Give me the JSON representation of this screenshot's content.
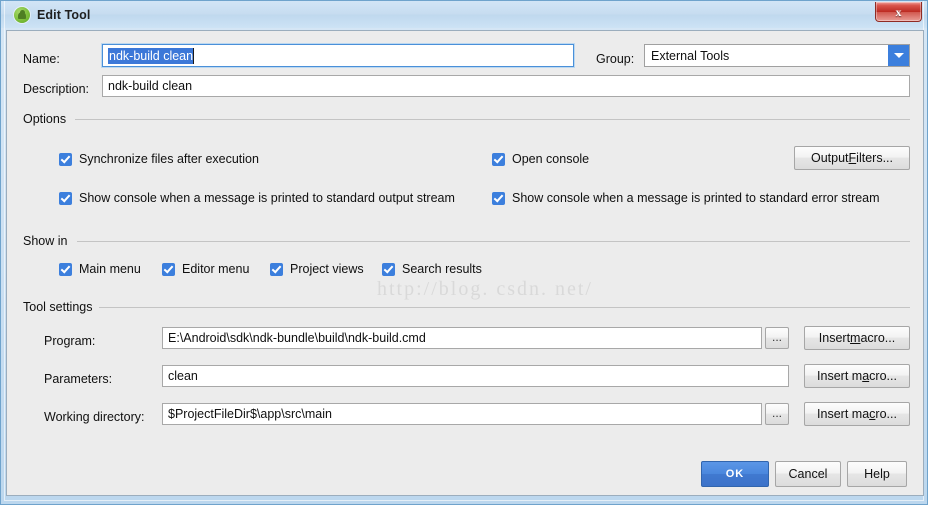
{
  "window": {
    "title": "Edit Tool",
    "app_icon": "android-robot-icon",
    "close_label": "x",
    "accent_color": "#3c7fdd",
    "dialog_bg": "#ececec"
  },
  "watermark": "http://blog. csdn. net/",
  "fields": {
    "name_label": "Name:",
    "name_value": "ndk-build clean",
    "name_selected": true,
    "description_label": "Description:",
    "description_value": "ndk-build clean",
    "group_label": "Group:",
    "group_value": "External Tools"
  },
  "options": {
    "title": "Options",
    "checkboxes": [
      {
        "label": "Synchronize files after execution",
        "checked": true
      },
      {
        "label": "Open console",
        "checked": true
      },
      {
        "label": "Show console when a message is printed to standard output stream",
        "checked": true
      },
      {
        "label": "Show console when a message is printed to standard error stream",
        "checked": true
      }
    ],
    "output_filters_pre": "Output ",
    "output_filters_accel": "F",
    "output_filters_post": "ilters..."
  },
  "show_in": {
    "title": "Show in",
    "checkboxes": [
      {
        "label": "Main menu",
        "checked": true
      },
      {
        "label": "Editor menu",
        "checked": true
      },
      {
        "label": "Project views",
        "checked": true
      },
      {
        "label": "Search results",
        "checked": true
      }
    ]
  },
  "tool_settings": {
    "title": "Tool settings",
    "program_label": "Program:",
    "program_value": "E:\\Android\\sdk\\ndk-bundle\\build\\ndk-build.cmd",
    "parameters_label": "Parameters:",
    "parameters_value": "clean",
    "working_directory_label": "Working directory:",
    "working_directory_value": "$ProjectFileDir$\\app\\src\\main",
    "browse_label": "...",
    "macro_buttons": [
      {
        "pre": "Insert ",
        "accel": "m",
        "post": "acro..."
      },
      {
        "pre": "Insert m",
        "accel": "a",
        "post": "cro..."
      },
      {
        "pre": "Insert ma",
        "accel": "c",
        "post": "ro..."
      }
    ]
  },
  "footer": {
    "ok": "OK",
    "cancel": "Cancel",
    "help": "Help"
  }
}
